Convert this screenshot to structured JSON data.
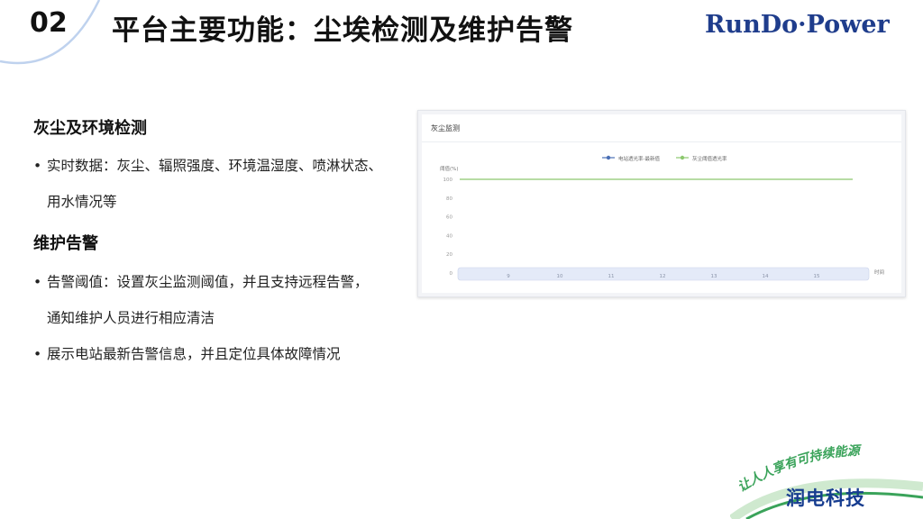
{
  "header": {
    "section_number": "02",
    "title": "平台主要功能：尘埃检测及维护告警",
    "logo_text": "RunDo·Power"
  },
  "content": {
    "heading_1": "灰尘及环境检测",
    "bullet_1_line1": "实时数据：灰尘、辐照强度、环境温湿度、喷淋状态、",
    "bullet_1_line2": "用水情况等",
    "heading_2": "维护告警",
    "bullet_2_line1": "告警阈值：设置灰尘监测阈值，并且支持远程告警，",
    "bullet_2_line2": "通知维护人员进行相应清洁",
    "bullet_3": "展示电站最新告警信息，并且定位具体故障情况",
    "bullet_symbol": "•"
  },
  "panel": {
    "title": "灰尘监测"
  },
  "chart_data": {
    "type": "line",
    "ylabel": "阈值(%)",
    "xlabel": "时间",
    "ylim": [
      0,
      100
    ],
    "y_ticks": [
      "0",
      "20",
      "40",
      "60",
      "80",
      "100"
    ],
    "x": [
      "9",
      "10",
      "11",
      "12",
      "13",
      "14",
      "15"
    ],
    "series": [
      {
        "name": "电站透光率-最新值",
        "color": "#4a6fb5",
        "values": []
      },
      {
        "name": "灰尘阈值透光率",
        "color": "#8cc86e",
        "values": [
          100,
          100,
          100,
          100,
          100,
          100,
          100
        ]
      }
    ]
  },
  "footer": {
    "slogan": "让人人享有可持续能源",
    "brand": "润电科技"
  },
  "colors": {
    "accent_blue": "#163c8f",
    "accent_green": "#3aa35a",
    "line_blue": "#4a6fb5",
    "line_green": "#8cc86e"
  }
}
